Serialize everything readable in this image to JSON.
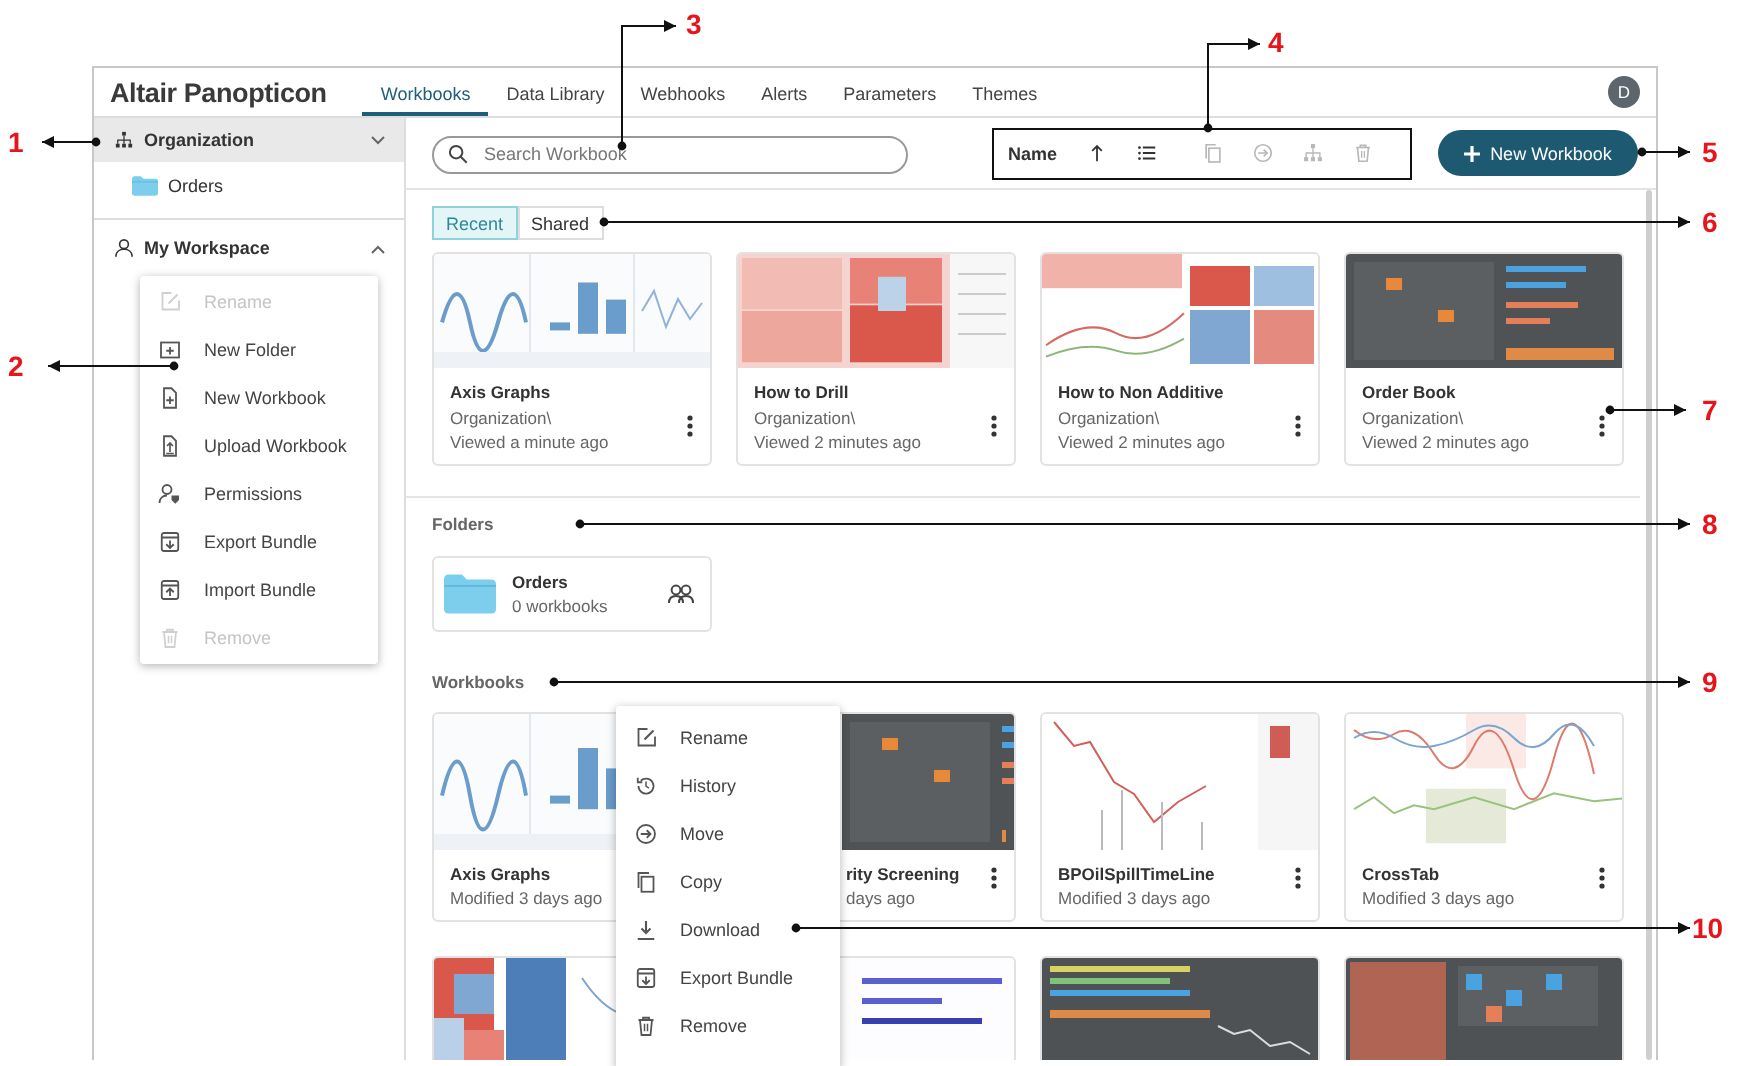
{
  "header": {
    "logo": "Altair Panopticon",
    "avatar": "D",
    "tabs": [
      {
        "label": "Workbooks",
        "selected": true
      },
      {
        "label": "Data Library",
        "selected": false
      },
      {
        "label": "Webhooks",
        "selected": false
      },
      {
        "label": "Alerts",
        "selected": false
      },
      {
        "label": "Parameters",
        "selected": false
      },
      {
        "label": "Themes",
        "selected": false
      }
    ]
  },
  "sidebar": {
    "items": [
      {
        "label": "Organization",
        "selected": true,
        "menu_open": false,
        "children": [
          {
            "label": "Orders",
            "selected": false
          }
        ]
      },
      {
        "label": "My Workspace",
        "selected": false,
        "menu_open": true
      }
    ]
  },
  "workspace_menu": {
    "items": [
      {
        "kind": "rename",
        "label": "Rename",
        "disabled": true
      },
      {
        "kind": "new-folder",
        "label": "New Folder",
        "disabled": false
      },
      {
        "kind": "new-workbook",
        "label": "New Workbook",
        "disabled": false
      },
      {
        "kind": "upload",
        "label": "Upload Workbook",
        "disabled": false
      },
      {
        "kind": "permissions",
        "label": "Permissions",
        "disabled": false
      },
      {
        "kind": "export",
        "label": "Export Bundle",
        "disabled": false
      },
      {
        "kind": "import",
        "label": "Import Bundle",
        "disabled": false
      },
      {
        "kind": "trash",
        "label": "Remove",
        "disabled": true
      }
    ]
  },
  "toolbar": {
    "search": {
      "placeholder": "Search Workbook"
    },
    "sort_label": "Name",
    "tools": [
      {
        "kind": "sort-up",
        "disabled": false
      },
      {
        "kind": "list",
        "disabled": false
      },
      {
        "kind": "copy",
        "disabled": true
      },
      {
        "kind": "move",
        "disabled": true
      },
      {
        "kind": "hierarchy",
        "disabled": true
      },
      {
        "kind": "trash",
        "disabled": true
      }
    ],
    "new_button": "New Workbook"
  },
  "filter_tabs": [
    {
      "label": "Recent",
      "selected": true
    },
    {
      "label": "Shared",
      "selected": false
    }
  ],
  "recent": [
    {
      "title": "Axis Graphs",
      "path": "Organization\\",
      "time": "Viewed a minute ago"
    },
    {
      "title": "How to Drill",
      "path": "Organization\\",
      "time": "Viewed 2 minutes ago"
    },
    {
      "title": "How to Non Additive",
      "path": "Organization\\",
      "time": "Viewed 2 minutes ago"
    },
    {
      "title": "Order Book",
      "path": "Organization\\",
      "time": "Viewed 2 minutes ago"
    }
  ],
  "folders": {
    "heading": "Folders",
    "items": [
      {
        "name": "Orders",
        "count": "0 workbooks"
      }
    ]
  },
  "workbooks": {
    "heading": "Workbooks",
    "items": [
      {
        "kind": "card",
        "title": "Axis Graphs",
        "time": "Modified 3 days ago"
      },
      {
        "kind": "covered",
        "title": "rity Screening",
        "time": "days ago"
      },
      {
        "kind": "card",
        "title": "BPOilSpillTimeLine",
        "time": "Modified 3 days ago"
      },
      {
        "kind": "card",
        "title": "CrossTab",
        "time": "Modified 3 days ago"
      },
      {
        "kind": "picture"
      },
      {
        "kind": "covered-picture"
      },
      {
        "kind": "picture"
      },
      {
        "kind": "picture"
      }
    ]
  },
  "workbook_menu": {
    "items": [
      {
        "kind": "rename",
        "label": "Rename"
      },
      {
        "kind": "history",
        "label": "History"
      },
      {
        "kind": "move",
        "label": "Move"
      },
      {
        "kind": "copy",
        "label": "Copy"
      },
      {
        "kind": "download",
        "label": "Download"
      },
      {
        "kind": "export",
        "label": "Export Bundle"
      },
      {
        "kind": "trash",
        "label": "Remove"
      }
    ]
  },
  "callouts": [
    "1",
    "2",
    "3",
    "4",
    "5",
    "6",
    "7",
    "8",
    "9",
    "10"
  ]
}
